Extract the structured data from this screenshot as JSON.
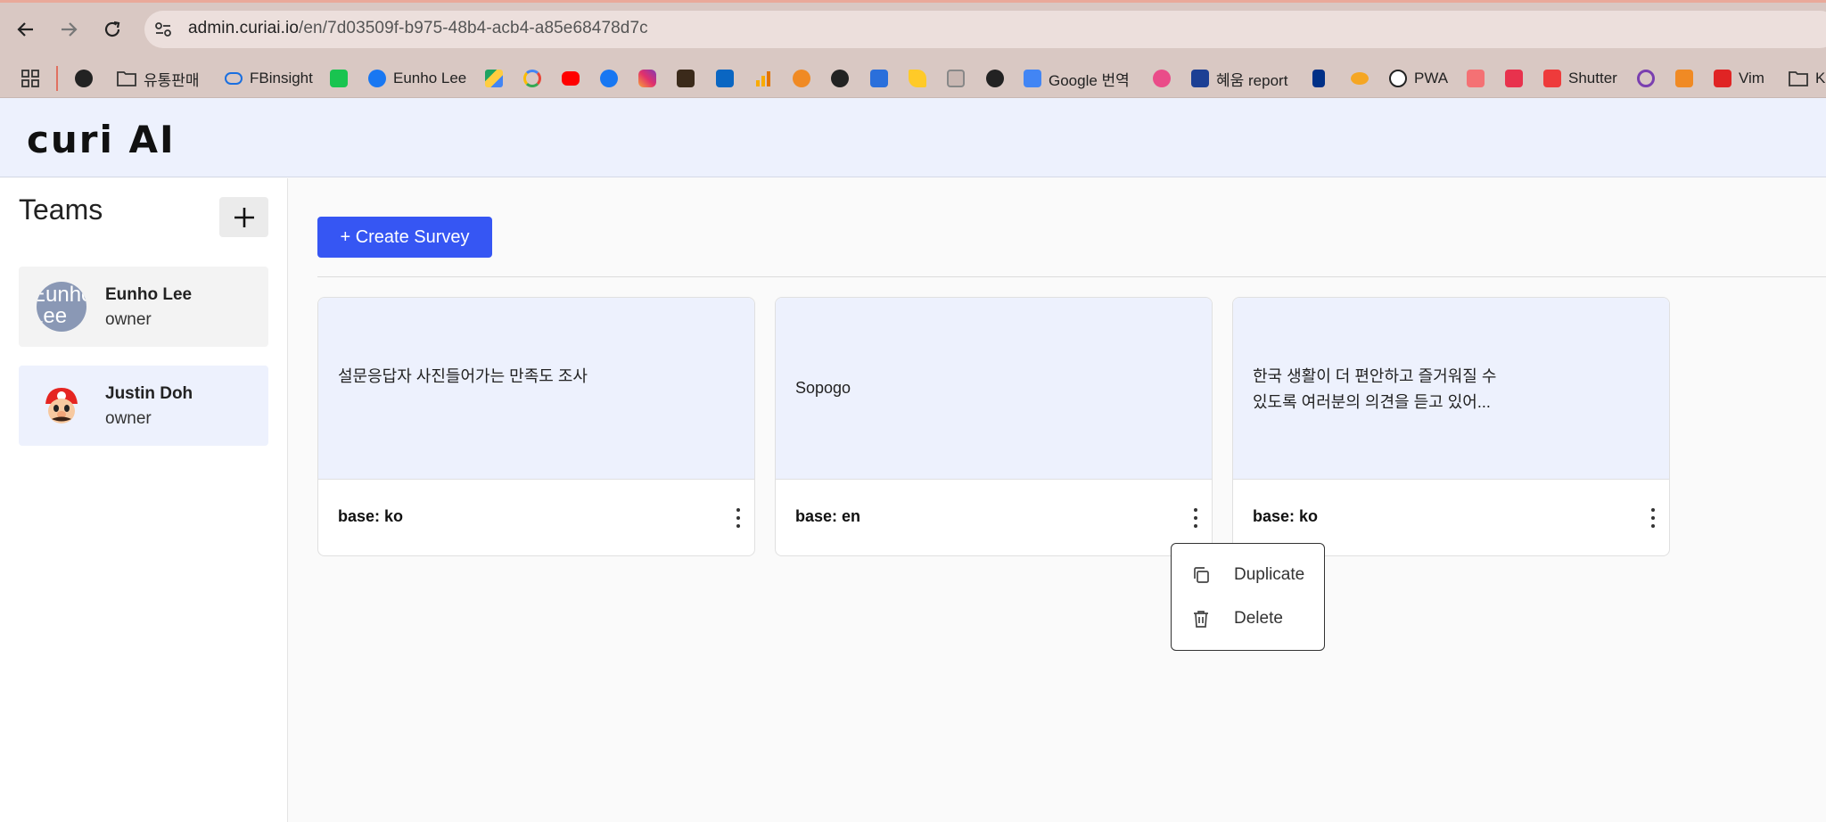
{
  "browser": {
    "url_domain": "admin.curiai.io",
    "url_path": "/en/7d03509f-b975-48b4-acb4-a85e68478d7c",
    "bookmarks": [
      {
        "label": "",
        "icon": "apps-grid-icon"
      },
      {
        "label": "",
        "icon": "github-icon"
      },
      {
        "label": "유통판매",
        "icon": "folder-icon"
      },
      {
        "label": "FBinsight",
        "icon": "meta-icon"
      },
      {
        "label": "",
        "icon": "naver-icon"
      },
      {
        "label": "Eunho Lee",
        "icon": "facebook-icon"
      },
      {
        "label": "",
        "icon": "drive-icon"
      },
      {
        "label": "",
        "icon": "google-icon"
      },
      {
        "label": "",
        "icon": "youtube-icon"
      },
      {
        "label": "",
        "icon": "facebook-icon"
      },
      {
        "label": "",
        "icon": "instagram-icon"
      },
      {
        "label": "",
        "icon": "ext-icon"
      },
      {
        "label": "",
        "icon": "linkedin-icon"
      },
      {
        "label": "",
        "icon": "analytics-icon"
      },
      {
        "label": "",
        "icon": "orange-icon"
      },
      {
        "label": "",
        "icon": "globe-icon"
      },
      {
        "label": "",
        "icon": "chart-icon"
      },
      {
        "label": "",
        "icon": "firebase-icon"
      },
      {
        "label": "",
        "icon": "storage-icon"
      },
      {
        "label": "",
        "icon": "github-icon"
      },
      {
        "label": "Google 번역",
        "icon": "translate-icon"
      },
      {
        "label": "",
        "icon": "dribbble-icon"
      },
      {
        "label": "혜움 report",
        "icon": "report-icon"
      },
      {
        "label": "",
        "icon": "paypal-icon"
      },
      {
        "label": "",
        "icon": "pie-icon"
      },
      {
        "label": "PWA",
        "icon": "pwa-icon"
      },
      {
        "label": "",
        "icon": "s-icon"
      },
      {
        "label": "",
        "icon": "ck-icon"
      },
      {
        "label": "Shutter",
        "icon": "shutter-icon"
      },
      {
        "label": "",
        "icon": "peace-icon"
      },
      {
        "label": "",
        "icon": "box-icon"
      },
      {
        "label": "Vim",
        "icon": "vim-icon"
      },
      {
        "label": "K",
        "icon": "folder-icon"
      }
    ]
  },
  "app": {
    "logo": "curi AI"
  },
  "sidebar": {
    "title": "Teams",
    "add_label": "+",
    "teams": [
      {
        "name": "Eunho Lee",
        "role": "owner",
        "avatar_text": "Eunho Lee"
      },
      {
        "name": "Justin Doh",
        "role": "owner",
        "avatar_text": ""
      }
    ]
  },
  "main": {
    "create_label": "+ Create Survey",
    "surveys": [
      {
        "title": "설문응답자 사진들어가는 만족도 조사",
        "base": "base: ko"
      },
      {
        "title": "Sopogo",
        "base": "base: en"
      },
      {
        "title": "한국 생활이 더 편안하고 즐거워질 수 있도록 여러분의 의견을 듣고 있어...",
        "base": "base: ko"
      }
    ],
    "menu": {
      "duplicate": "Duplicate",
      "delete": "Delete"
    }
  },
  "colors": {
    "primary": "#3656f3",
    "card_header": "#edf1fd",
    "chrome": "#d9c8c3"
  }
}
